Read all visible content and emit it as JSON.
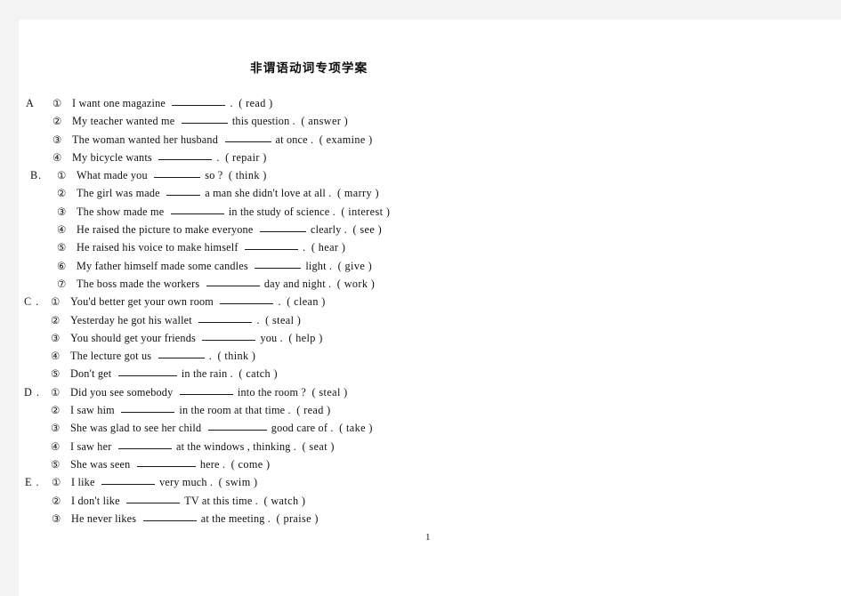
{
  "document": {
    "title": "非谓语动词专项学案",
    "page_number": "1"
  },
  "sections": [
    {
      "label": "A",
      "items": [
        {
          "marker": "①",
          "before": "I  want  one  magazine",
          "blank": "b-l",
          "after": ".",
          "cue": "( read )"
        },
        {
          "marker": "②",
          "before": "My  teacher  wanted  me",
          "blank": "b-m",
          "after": "this  question  .",
          "cue": "( answer )"
        },
        {
          "marker": "③",
          "before": "The  woman  wanted  her  husband",
          "blank": "b-m",
          "after": "at  once  .",
          "cue": "( examine )"
        },
        {
          "marker": "④",
          "before": "My  bicycle  wants",
          "blank": "b-l",
          "after": ".",
          "cue": "( repair )"
        }
      ]
    },
    {
      "label": "B.",
      "items": [
        {
          "marker": "①",
          "before": "What  made  you",
          "blank": "b-m",
          "after": "so  ?",
          "cue": "( think )"
        },
        {
          "marker": "②",
          "before": "The  girl  was  made",
          "blank": "b-s",
          "after": "a  man  she  didn't  love  at  all  .",
          "cue": "( marry )"
        },
        {
          "marker": "③",
          "before": "The  show  made  me",
          "blank": "b-l",
          "after": "in  the  study  of  science  .",
          "cue": "( interest )"
        },
        {
          "marker": "④",
          "before": "He  raised  the  picture  to  make  everyone",
          "blank": "b-m",
          "after": "clearly  .",
          "cue": "( see )"
        },
        {
          "marker": "⑤",
          "before": "He  raised  his  voice  to  make  himself",
          "blank": "b-l",
          "after": ".",
          "cue": "( hear )"
        },
        {
          "marker": "⑥",
          "before": "My  father  himself   made  some  candles",
          "blank": "b-m",
          "after": "light  .",
          "cue": "( give )"
        },
        {
          "marker": "⑦",
          "before": "The  boss  made  the  workers",
          "blank": "b-l",
          "after": "day  and  night  .",
          "cue": "( work )"
        }
      ]
    },
    {
      "label": "C .",
      "items": [
        {
          "marker": "①",
          "before": "You'd  better  get  your  own  room",
          "blank": "b-l",
          "after": ".",
          "cue": "( clean )"
        },
        {
          "marker": "②",
          "before": "Yesterday  he  got  his  wallet",
          "blank": "b-l",
          "after": ".",
          "cue": "( steal )"
        },
        {
          "marker": "③",
          "before": "You  should  get  your  friends",
          "blank": "b-l",
          "after": "you  .",
          "cue": "( help )"
        },
        {
          "marker": "④",
          "before": "The  lecture  got  us",
          "blank": "b-m",
          "after": ".",
          "cue": "( think )"
        },
        {
          "marker": "⑤",
          "before": "Don't  get",
          "blank": "b-xl",
          "after": "in  the  rain  .",
          "cue": "( catch )"
        }
      ]
    },
    {
      "label": "D .",
      "items": [
        {
          "marker": "①",
          "before": "Did  you  see  somebody",
          "blank": "b-l",
          "after": "into  the  room  ?",
          "cue": "( steal )"
        },
        {
          "marker": "②",
          "before": "I  saw  him",
          "blank": "b-l",
          "after": "in  the  room  at  that  time  .",
          "cue": "( read )"
        },
        {
          "marker": "③",
          "before": "She  was  glad  to  see  her  child",
          "blank": "b-xl",
          "after": "good  care  of  .",
          "cue": "( take )"
        },
        {
          "marker": "④",
          "before": "I  saw  her",
          "blank": "b-l",
          "after": "at  the  windows  ,  thinking  .",
          "cue": "( seat )"
        },
        {
          "marker": "⑤",
          "before": "She  was  seen",
          "blank": "b-xl",
          "after": "here  .",
          "cue": "( come )"
        }
      ]
    },
    {
      "label": "E .",
      "items": [
        {
          "marker": "①",
          "before": "I  like",
          "blank": "b-l",
          "after": "very  much  .",
          "cue": "( swim )"
        },
        {
          "marker": "②",
          "before": "I  don't  like",
          "blank": "b-l",
          "after": "TV  at  this  time  .",
          "cue": "( watch )"
        },
        {
          "marker": "③",
          "before": "He  never  likes",
          "blank": "b-l",
          "after": "at  the  meeting  .",
          "cue": "( praise )"
        }
      ]
    }
  ]
}
